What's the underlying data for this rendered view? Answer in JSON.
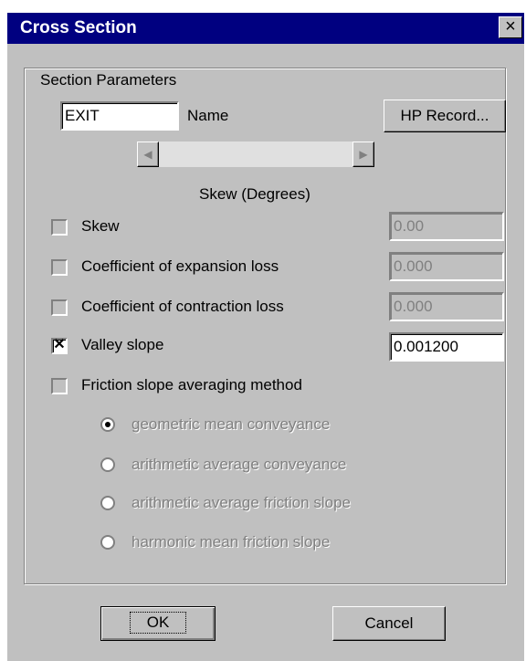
{
  "window": {
    "title": "Cross Section",
    "close_glyph": "×"
  },
  "section": {
    "group_label": "Section Parameters",
    "name_value": "EXIT",
    "name_label": "Name",
    "hp_button": "HP Record...",
    "skew_caption": "Skew (Degrees)"
  },
  "options": [
    {
      "label": "Skew",
      "checked": false,
      "value": "0.00",
      "enabled": false
    },
    {
      "label": "Coefficient of expansion loss",
      "checked": false,
      "value": "0.000",
      "enabled": false
    },
    {
      "label": "Coefficient of contraction loss",
      "checked": false,
      "value": "0.000",
      "enabled": false
    },
    {
      "label": "Valley slope",
      "checked": true,
      "value": "0.001200",
      "enabled": true
    },
    {
      "label": "Friction slope averaging method",
      "checked": false
    }
  ],
  "methods": [
    {
      "label": "geometric mean conveyance",
      "selected": true
    },
    {
      "label": "arithmetic average conveyance",
      "selected": false
    },
    {
      "label": "arithmetic average friction slope",
      "selected": false
    },
    {
      "label": "harmonic mean friction slope",
      "selected": false
    }
  ],
  "buttons": {
    "ok": "OK",
    "cancel": "Cancel"
  }
}
